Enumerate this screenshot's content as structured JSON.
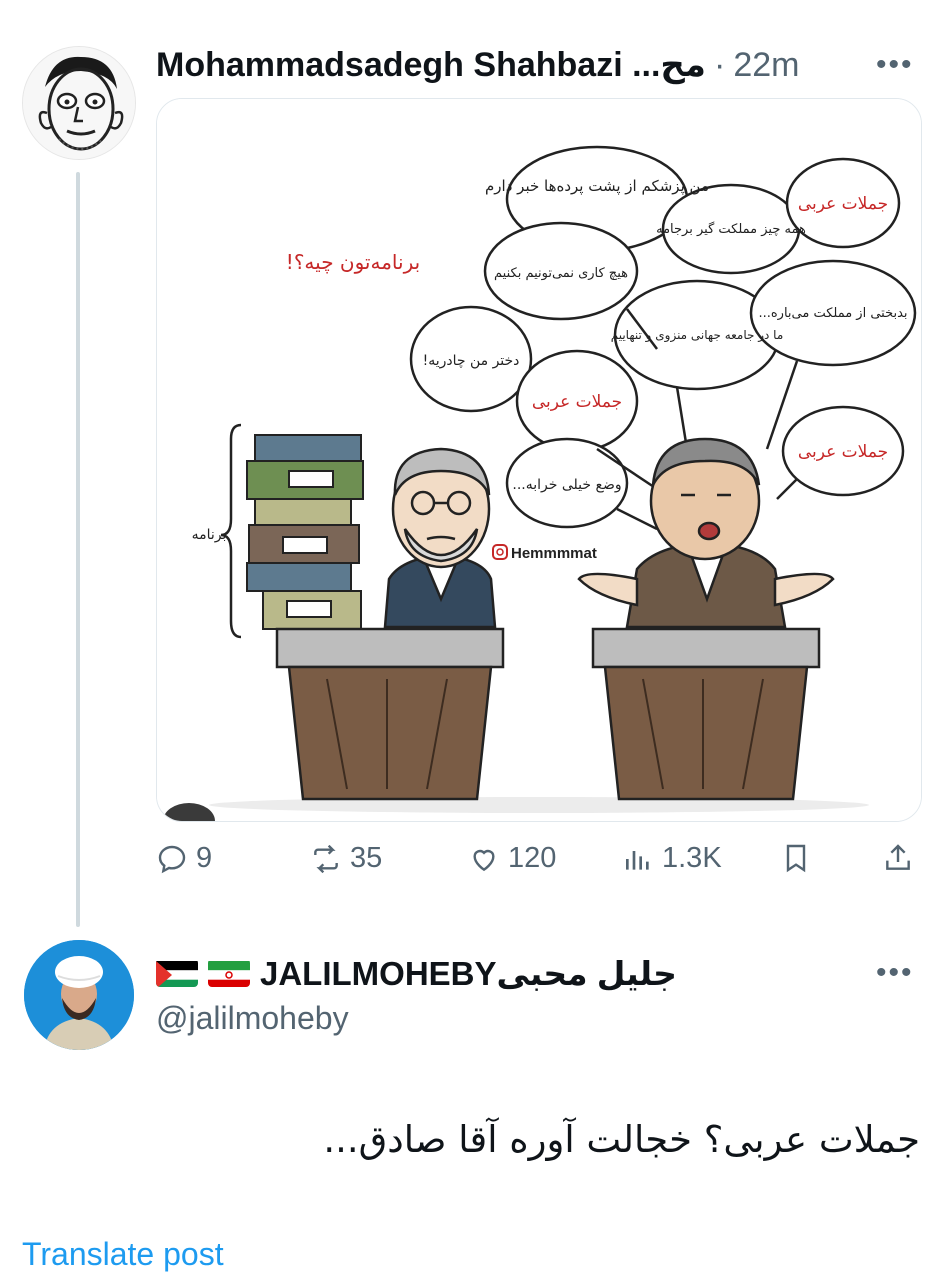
{
  "tweet1": {
    "author_name": "Mohammadsadegh Shahbazi ...مح",
    "dot": "·",
    "time": "22m",
    "more": "•••",
    "cartoon": {
      "question": "برنامه‌تون چیه؟!",
      "side_label": "برنامه",
      "watermark": "Hemmmmat",
      "bubbles": [
        "من پزشکم از پشت پرده‌ها خبر دارم",
        "همه چیز مملکت گیر برجامه",
        "جملات عربی",
        "هیچ کاری نمی‌تونیم بکنیم",
        "ما در جامعه جهانی منزوی و تنهاییم",
        "بدبختی از مملکت می‌باره...",
        "دختر من چادریه!",
        "جملات عربی",
        "جملات عربی",
        "وضع خیلی خرابه..."
      ]
    },
    "stats": {
      "replies": "9",
      "reposts": "35",
      "likes": "120",
      "views": "1.3K"
    }
  },
  "tweet2": {
    "display_name": "JALILMOHEBYجلیل محبی",
    "handle": "@jalilmoheby",
    "more": "•••",
    "body": "جملات عربی؟ خجالت آوره آقا صادق...",
    "translate": "Translate post"
  }
}
